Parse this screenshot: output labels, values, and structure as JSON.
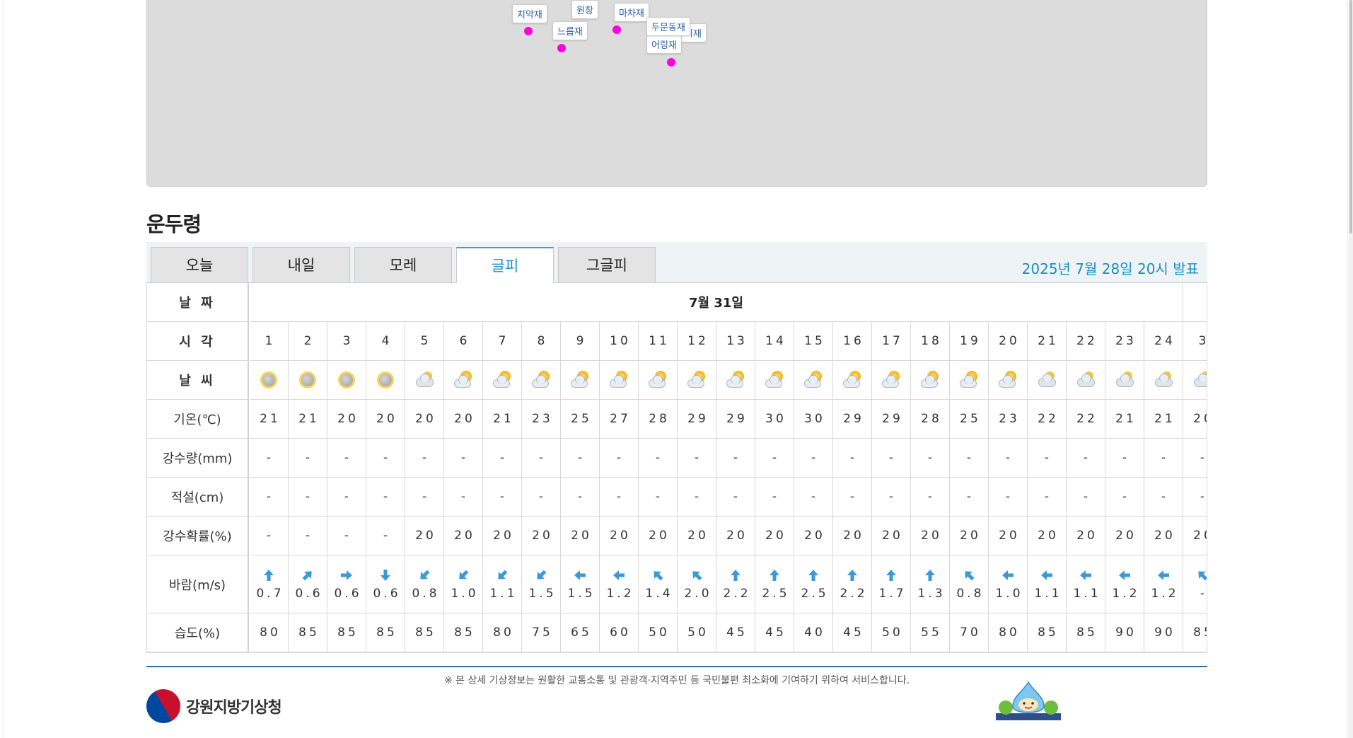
{
  "map": {
    "labels": [
      "치악재",
      "느릅재",
      "마차재",
      "두문동재",
      "어링재",
      "원창",
      "피재"
    ]
  },
  "station": {
    "title": "운두령"
  },
  "tabs": [
    {
      "label": "오늘"
    },
    {
      "label": "내일"
    },
    {
      "label": "모레"
    },
    {
      "label": "글피"
    },
    {
      "label": "그글피"
    }
  ],
  "active_tab": "글피",
  "issued": "2025년 7월 28일 20시 발표",
  "table": {
    "row_headers": {
      "date": "날 짜",
      "time": "시 각",
      "weather": "날 씨",
      "temp": "기온(℃)",
      "rain": "강수량(mm)",
      "snow": "적설(cm)",
      "pop": "강수확률(%)",
      "wind": "바람(m/s)",
      "humidity": "습도(%)"
    },
    "date": "7월 31일",
    "hours": [
      "1",
      "2",
      "3",
      "4",
      "5",
      "6",
      "7",
      "8",
      "9",
      "10",
      "11",
      "12",
      "13",
      "14",
      "15",
      "16",
      "17",
      "18",
      "19",
      "20",
      "21",
      "22",
      "23",
      "24",
      "3"
    ],
    "weather": [
      "night-cloudy-icon",
      "night-cloudy-icon",
      "night-cloudy-icon",
      "night-cloudy-icon",
      "mostly-cloudy-icon",
      "partly-cloudy-icon",
      "partly-cloudy-icon",
      "partly-cloudy-icon",
      "partly-cloudy-icon",
      "partly-cloudy-icon",
      "partly-cloudy-icon",
      "partly-cloudy-icon",
      "partly-cloudy-icon",
      "partly-cloudy-icon",
      "partly-cloudy-icon",
      "partly-cloudy-icon",
      "partly-cloudy-icon",
      "partly-cloudy-icon",
      "partly-cloudy-icon",
      "partly-cloudy-icon",
      "mostly-cloudy-icon",
      "mostly-cloudy-icon",
      "mostly-cloudy-icon",
      "mostly-cloudy-icon",
      "mostly-cloudy-icon"
    ],
    "temp": [
      "21",
      "21",
      "20",
      "20",
      "20",
      "20",
      "21",
      "23",
      "25",
      "27",
      "28",
      "29",
      "29",
      "30",
      "30",
      "29",
      "29",
      "28",
      "25",
      "23",
      "22",
      "22",
      "21",
      "21",
      "20"
    ],
    "rain": [
      "-",
      "-",
      "-",
      "-",
      "-",
      "-",
      "-",
      "-",
      "-",
      "-",
      "-",
      "-",
      "-",
      "-",
      "-",
      "-",
      "-",
      "-",
      "-",
      "-",
      "-",
      "-",
      "-",
      "-",
      "-"
    ],
    "snow": [
      "-",
      "-",
      "-",
      "-",
      "-",
      "-",
      "-",
      "-",
      "-",
      "-",
      "-",
      "-",
      "-",
      "-",
      "-",
      "-",
      "-",
      "-",
      "-",
      "-",
      "-",
      "-",
      "-",
      "-",
      "-"
    ],
    "pop": [
      "-",
      "-",
      "-",
      "-",
      "20",
      "20",
      "20",
      "20",
      "20",
      "20",
      "20",
      "20",
      "20",
      "20",
      "20",
      "20",
      "20",
      "20",
      "20",
      "20",
      "20",
      "20",
      "20",
      "20",
      "20"
    ],
    "wind_dir": [
      "up",
      "up-right",
      "right",
      "down",
      "down-left",
      "down-left",
      "down-left",
      "down-left",
      "left",
      "left",
      "up-left",
      "up-left",
      "up",
      "up",
      "up",
      "up",
      "up",
      "up",
      "up-left",
      "left",
      "left",
      "left",
      "left",
      "left",
      "up-left"
    ],
    "wind_speed": [
      "0.7",
      "0.6",
      "0.6",
      "0.6",
      "0.8",
      "1.0",
      "1.1",
      "1.5",
      "1.5",
      "1.2",
      "1.4",
      "2.0",
      "2.2",
      "2.5",
      "2.5",
      "2.2",
      "1.7",
      "1.3",
      "0.8",
      "1.0",
      "1.1",
      "1.1",
      "1.2",
      "1.2",
      "-"
    ],
    "humidity": [
      "80",
      "85",
      "85",
      "85",
      "85",
      "85",
      "80",
      "75",
      "65",
      "60",
      "50",
      "50",
      "45",
      "45",
      "40",
      "45",
      "50",
      "55",
      "70",
      "80",
      "85",
      "85",
      "90",
      "90",
      "85"
    ]
  },
  "footer": {
    "note": "※ 본 상세 기상정보는 원활한 교통소통 및 관광객·지역주민 등 국민불편 최소화에 기여하기 위하여 서비스합니다.",
    "logo_text": "강원지방기상청"
  },
  "colors": {
    "accent": "#1a94c4",
    "arrow": "#3a9ad9",
    "map_marker": "#ff00e1",
    "footer_line": "#2f6e9e"
  }
}
